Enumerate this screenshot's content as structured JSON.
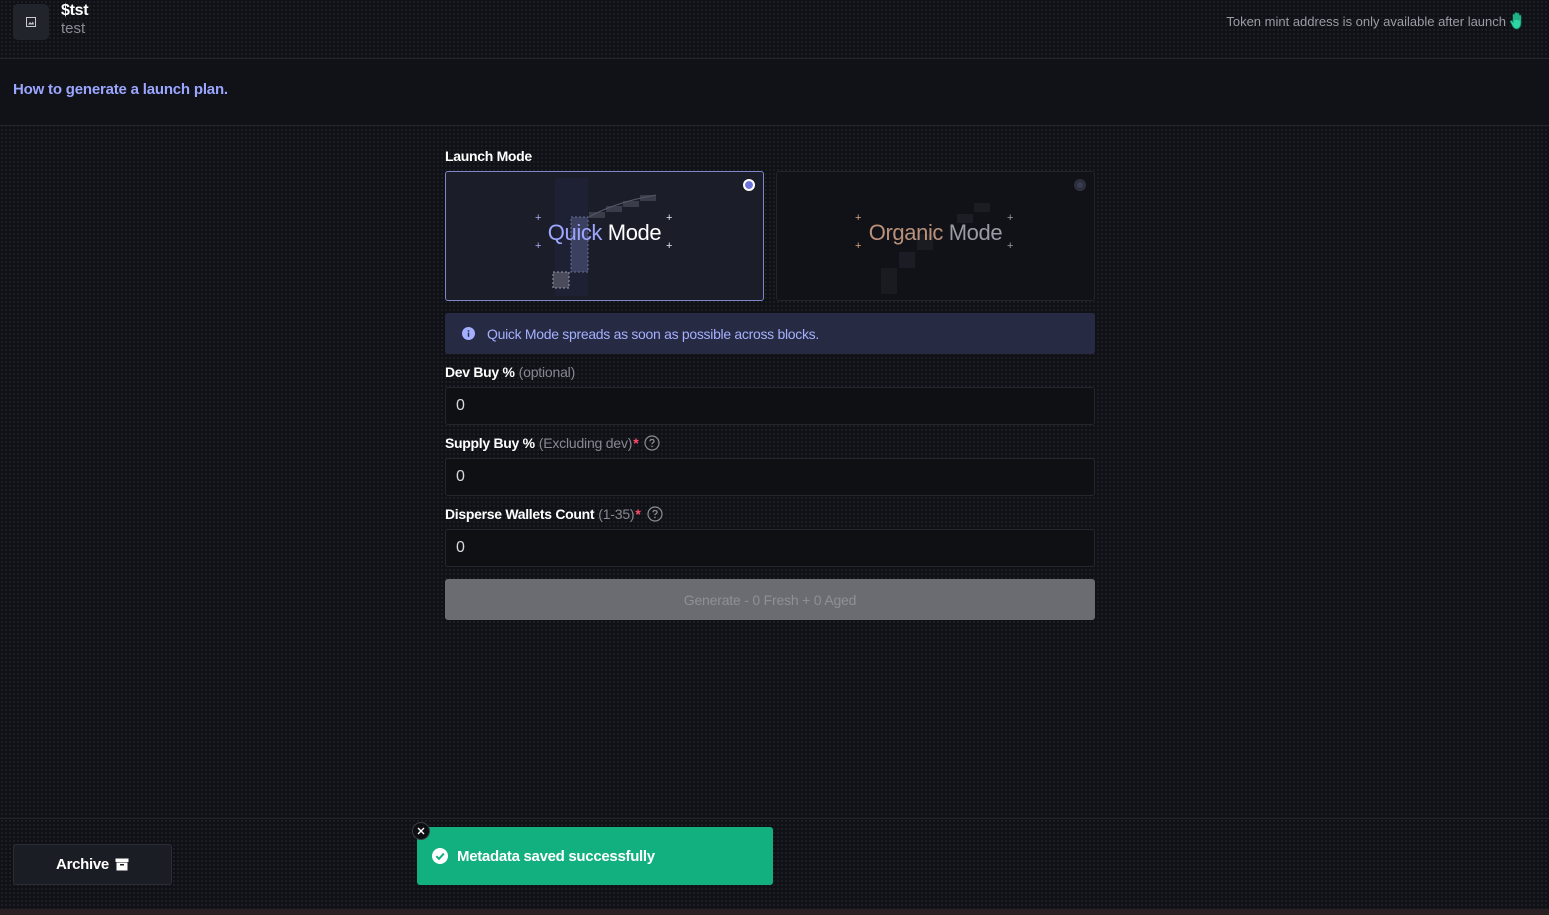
{
  "header": {
    "token_symbol": "$tst",
    "token_name": "test",
    "mint_note": "Token mint address is only available after launch"
  },
  "subheader": {
    "howto_link": "How to generate a launch plan."
  },
  "form": {
    "launch_mode_label": "Launch Mode",
    "modes": [
      {
        "word1": "Quick",
        "word2": "Mode",
        "selected": true
      },
      {
        "word1": "Organic",
        "word2": "Mode",
        "selected": false
      }
    ],
    "info_text": "Quick Mode spreads as soon as possible across blocks.",
    "dev_buy": {
      "label": "Dev Buy %",
      "hint": "(optional)",
      "value": "0"
    },
    "supply_buy": {
      "label": "Supply Buy %",
      "hint": "(Excluding dev)",
      "required": "*",
      "value": "0"
    },
    "disperse": {
      "label": "Disperse Wallets Count",
      "hint": "(1-35)",
      "required": "*",
      "value": "0"
    },
    "generate_label": "Generate - 0 Fresh + 0 Aged"
  },
  "footer": {
    "archive_label": "Archive"
  },
  "toast": {
    "message": "Metadata saved successfully"
  },
  "colors": {
    "accent": "#6c73d9",
    "link": "#9aa6ff",
    "success": "#12b07e",
    "required": "#ff4b6b"
  },
  "icons": {
    "token_image": "image-placeholder-icon",
    "mint_note": "waving-hand-icon",
    "info": "info-icon",
    "help": "question-circle-icon",
    "archive": "archive-box-icon",
    "toast_success": "check-circle-icon",
    "toast_close": "close-icon"
  }
}
